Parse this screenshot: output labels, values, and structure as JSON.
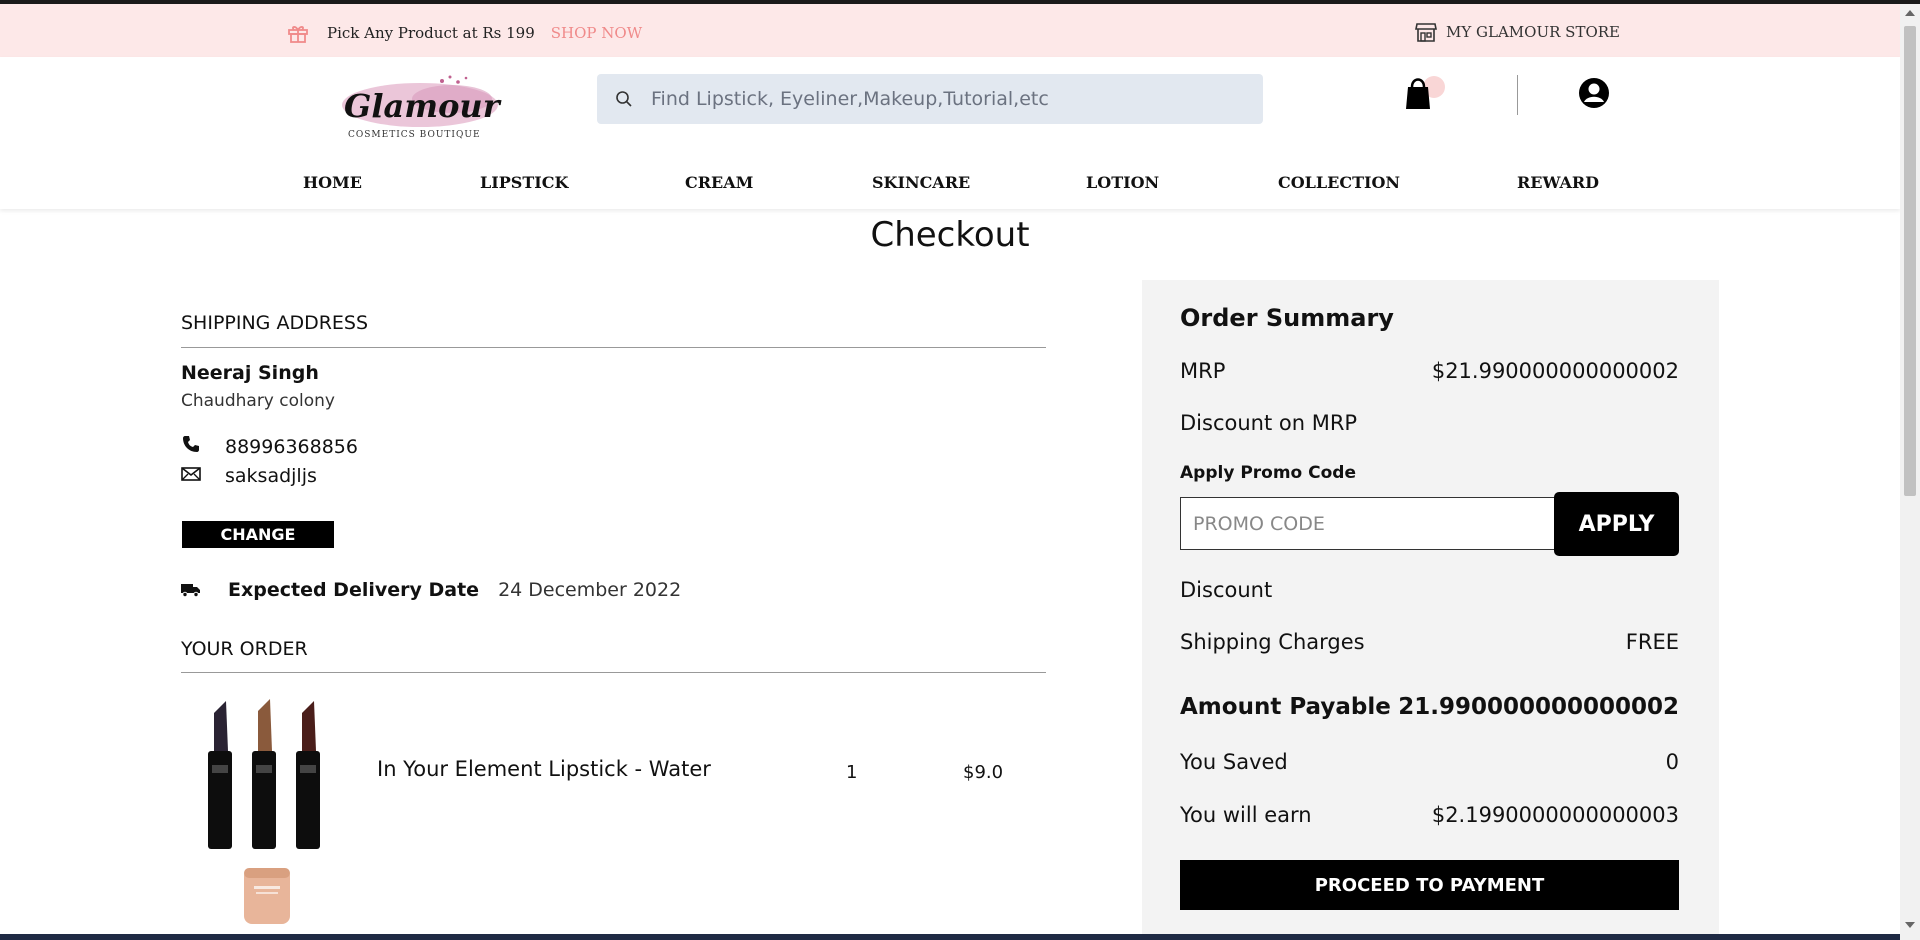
{
  "promo_bar": {
    "text": "Pick Any Product at Rs 199",
    "link": "SHOP NOW",
    "store": "MY GLAMOUR STORE",
    "link_color": "#f08a8a",
    "background": "#fde8e8"
  },
  "header": {
    "logo_text": "Glamour",
    "logo_subtext": "COSMETICS BOUTIQUE",
    "search_placeholder": "Find Lipstick, Eyeliner,Makeup,Tutorial,etc",
    "icons": [
      "gift-icon",
      "store-icon",
      "search-icon",
      "cart-icon",
      "account-icon"
    ]
  },
  "nav": [
    "HOME",
    "LIPSTICK",
    "CREAM",
    "SKINCARE",
    "LOTION",
    "COLLECTION",
    "REWARD"
  ],
  "page_title": "Checkout",
  "shipping": {
    "title": "SHIPPING ADDRESS",
    "name": "Neeraj Singh",
    "address": "Chaudhary colony",
    "phone": "88996368856",
    "email": "saksadjljs",
    "change_label": "CHANGE",
    "delivery_label": "Expected Delivery Date",
    "delivery_date": "24 December 2022"
  },
  "order": {
    "title": "YOUR ORDER",
    "items": [
      {
        "name": "In Your Element Lipstick - Water",
        "qty": "1",
        "price": "$9.0"
      }
    ]
  },
  "summary": {
    "title": "Order Summary",
    "mrp_label": "MRP",
    "mrp_value": "$21.990000000000002",
    "discount_mrp_label": "Discount on MRP",
    "promo_label": "Apply Promo Code",
    "promo_placeholder": "PROMO CODE",
    "apply_label": "APPLY",
    "discount_label": "Discount",
    "shipping_label": "Shipping Charges",
    "shipping_value": "FREE",
    "payable_label": "Amount Payable",
    "payable_value": "21.990000000000002",
    "saved_label": "You Saved",
    "saved_value": "0",
    "earn_label": "You will earn",
    "earn_value": "$2.1990000000000003",
    "pay_label": "PROCEED TO PAYMENT"
  },
  "colors": {
    "accent": "#000000",
    "summary_bg": "#f3f3f3",
    "search_bg": "#e2e8f0"
  }
}
